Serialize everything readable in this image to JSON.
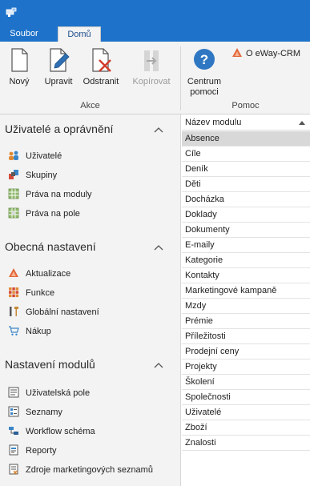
{
  "ribbon": {
    "tabs": [
      "Soubor",
      "Domů"
    ],
    "buttons": {
      "new": "Nový",
      "edit": "Upravit",
      "delete": "Odstranit",
      "copy": "Kopírovat",
      "help_line1": "Centrum",
      "help_line2": "pomoci",
      "about": "O eWay-CRM"
    },
    "groups": {
      "actions": "Akce",
      "help": "Pomoc"
    }
  },
  "nav": {
    "sections": [
      {
        "title": "Uživatelé a oprávnění",
        "items": [
          "Uživatelé",
          "Skupiny",
          "Práva na moduly",
          "Práva na pole"
        ]
      },
      {
        "title": "Obecná nastavení",
        "items": [
          "Aktualizace",
          "Funkce",
          "Globální nastavení",
          "Nákup"
        ]
      },
      {
        "title": "Nastavení modulů",
        "items": [
          "Uživatelská pole",
          "Seznamy",
          "Workflow schéma",
          "Reporty",
          "Zdroje marketingových seznamů"
        ]
      }
    ]
  },
  "list": {
    "header": "Název modulu",
    "rows": [
      "Absence",
      "Cíle",
      "Deník",
      "Děti",
      "Docházka",
      "Doklady",
      "Dokumenty",
      "E-maily",
      "Kategorie",
      "Kontakty",
      "Marketingové kampaně",
      "Mzdy",
      "Prémie",
      "Příležitosti",
      "Prodejní ceny",
      "Projekty",
      "Školení",
      "Společnosti",
      "Uživatelé",
      "Zboží",
      "Znalosti"
    ],
    "selected": "Absence"
  },
  "colors": {
    "accent": "#1e72c9",
    "ribbon_bg": "#f3f3f3",
    "selected_row": "#d8d8d8"
  }
}
